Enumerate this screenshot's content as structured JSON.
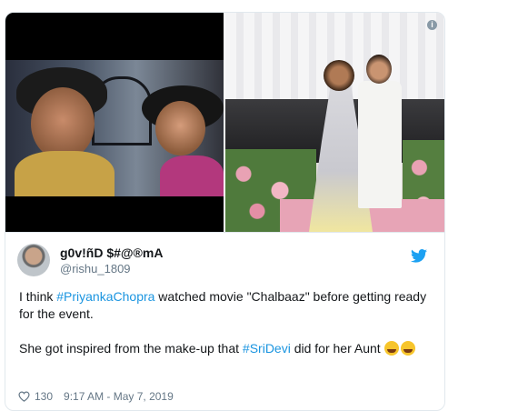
{
  "media": {
    "left_alt": "",
    "right_info_icon": "info-icon"
  },
  "author": {
    "name": "g0v!ñD $#@®mA",
    "handle": "@rishu_1809"
  },
  "tweet": {
    "line1_prefix": "I think ",
    "hashtag1": "#PriyankaChopra",
    "line1_suffix": " watched movie \"Chalbaaz\" before getting ready for the event.",
    "line2_prefix": "She got inspired from the make-up that ",
    "hashtag2": "#SriDevi",
    "line2_suffix": " did for her Aunt "
  },
  "meta": {
    "likes": "130",
    "timestamp": "9:17 AM - May 7, 2019"
  },
  "colors": {
    "link": "#1b95e0",
    "twitter_blue": "#1da1f2",
    "muted": "#657786"
  }
}
